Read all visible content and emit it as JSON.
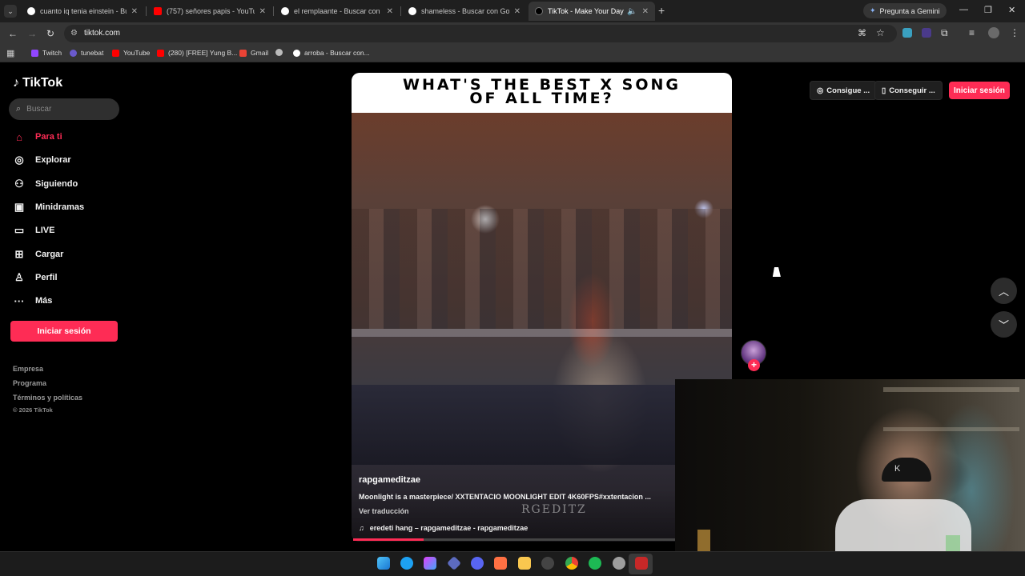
{
  "browser": {
    "tabs": [
      {
        "title": "cuanto iq tenia einstein - Busca",
        "favicon_color": "#ffffff",
        "active": false
      },
      {
        "title": "(757) señores papis - YouTube",
        "favicon_color": "#ff0000",
        "active": false
      },
      {
        "title": "el remplaante - Buscar con Goo",
        "favicon_color": "#ffffff",
        "active": false
      },
      {
        "title": "shameless - Buscar con Google",
        "favicon_color": "#ffffff",
        "active": false
      },
      {
        "title": "TikTok - Make Your Day",
        "favicon_color": "#000000",
        "active": true
      }
    ],
    "new_tab_icon": "+",
    "gemini_label": "Pregunta a Gemini",
    "url": "tiktok.com",
    "bookmarks": [
      {
        "label": "Twitch",
        "color": "#9146ff"
      },
      {
        "label": "tunebat",
        "color": "#6a5acd"
      },
      {
        "label": "YouTube",
        "color": "#ff0000"
      },
      {
        "label": "(280) [FREE] Yung B...",
        "color": "#ff0000"
      },
      {
        "label": "Gmail",
        "color": "#ea4335"
      },
      {
        "label": "",
        "color": "#bbbbbb"
      },
      {
        "label": "arroba - Buscar con...",
        "color": "#ffffff"
      }
    ]
  },
  "tiktok": {
    "logo_text": "TikTok",
    "search_placeholder": "Buscar",
    "nav": [
      {
        "label": "Para ti",
        "icon": "home-icon",
        "glyph": "⌂",
        "active": true
      },
      {
        "label": "Explorar",
        "icon": "compass-icon",
        "glyph": "◎",
        "active": false
      },
      {
        "label": "Siguiendo",
        "icon": "user-follow-icon",
        "glyph": "⚇",
        "active": false
      },
      {
        "label": "Minidramas",
        "icon": "film-icon",
        "glyph": "▣",
        "active": false
      },
      {
        "label": "LIVE",
        "icon": "live-icon",
        "glyph": "▭",
        "active": false
      },
      {
        "label": "Cargar",
        "icon": "upload-icon",
        "glyph": "⊞",
        "active": false
      },
      {
        "label": "Perfil",
        "icon": "profile-icon",
        "glyph": "♙",
        "active": false
      },
      {
        "label": "Más",
        "icon": "more-icon",
        "glyph": "···",
        "active": false
      }
    ],
    "login_label": "Iniciar sesión",
    "footer": [
      "Empresa",
      "Programa",
      "Términos y políticas"
    ],
    "copyright": "© 2026 TikTok",
    "header_buttons": [
      "Consigue ...",
      "Conseguir ..."
    ],
    "header_login": "Iniciar sesión",
    "accent": "#fe2c55",
    "video": {
      "banner_line1": "WHAT'S THE BEST X SONG",
      "banner_line2": "OF ALL TIME?",
      "username": "rapgameditzae",
      "description": "Moonlight is a masterpiece/ XXTENTACIO MOONLIGHT EDIT 4K60FPS#xxtentacion ...",
      "translate_label": "Ver traducción",
      "watermark": "RGEDITZ",
      "music": "eredeti hang – rapgameditzae - rapgameditzae",
      "progress_fraction": 0.22
    }
  }
}
